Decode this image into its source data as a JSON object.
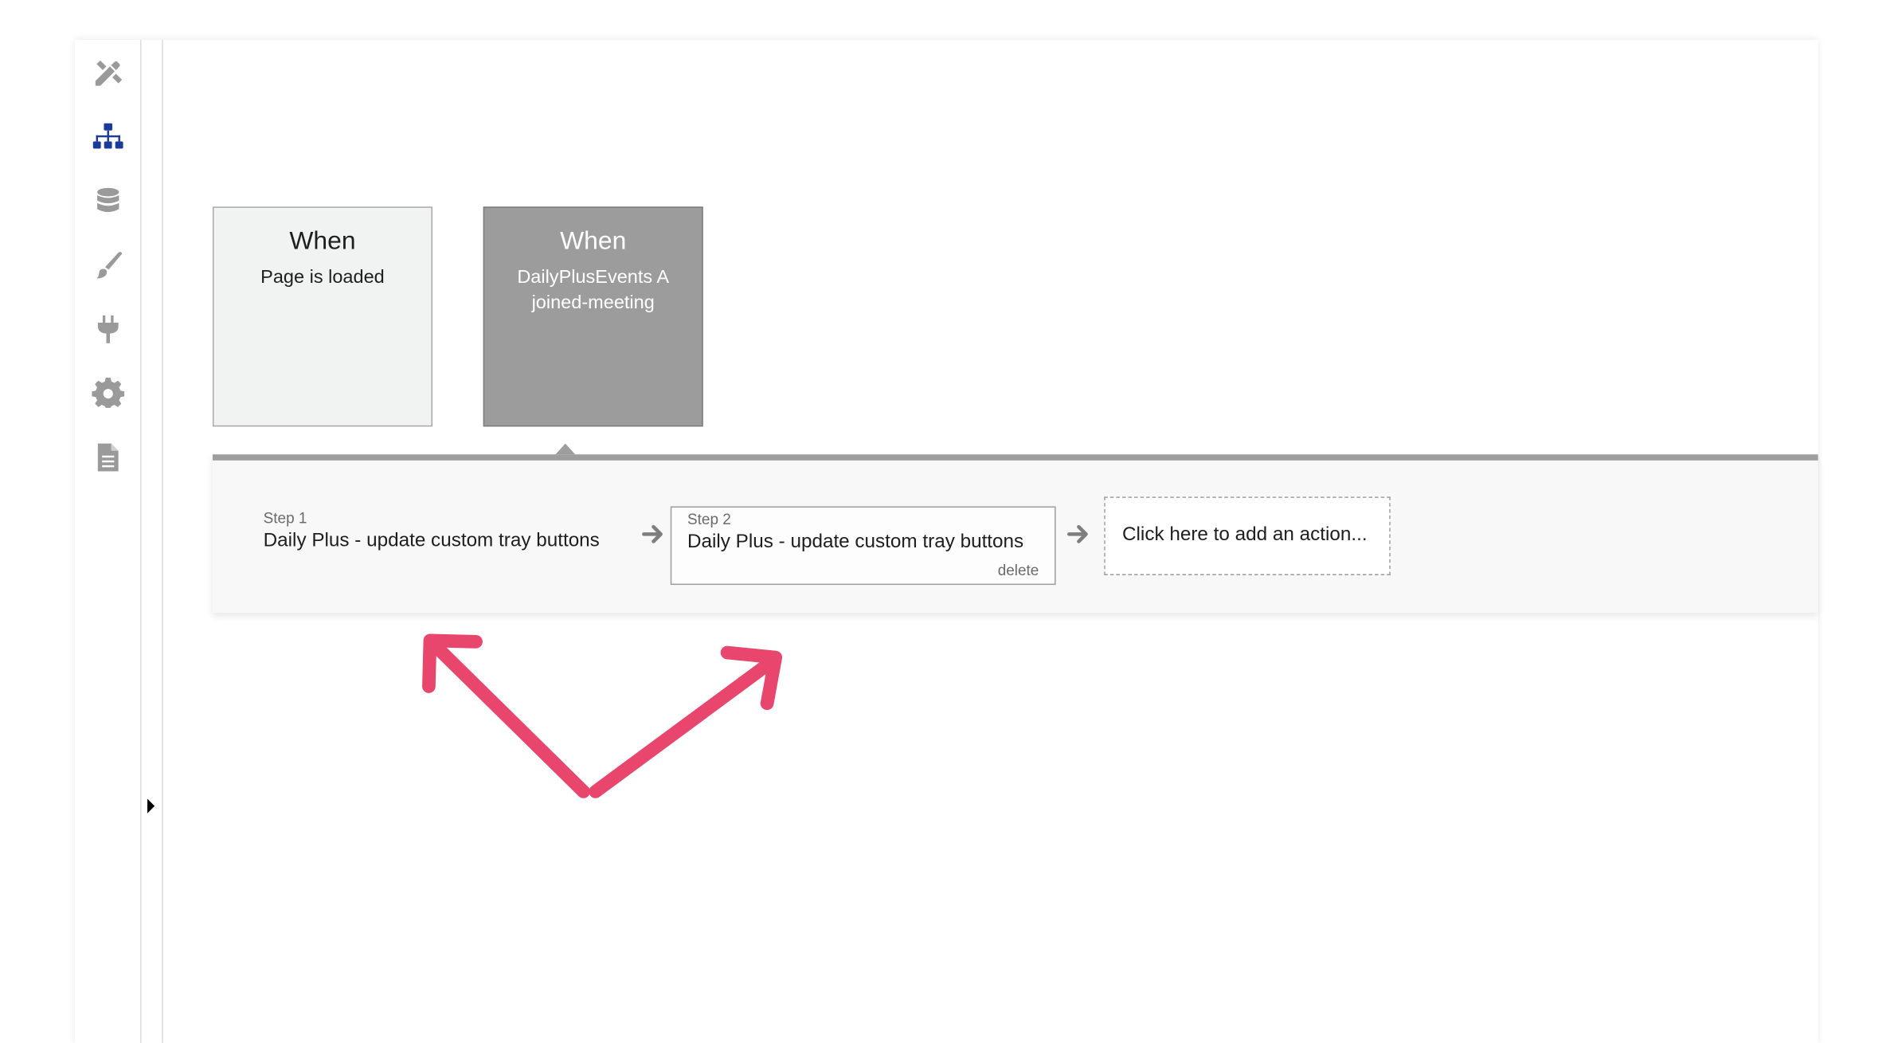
{
  "sidebar": {
    "items": [
      {
        "name": "design",
        "icon": "design-tools-icon",
        "active": false
      },
      {
        "name": "workflow",
        "icon": "workflow-sitemap-icon",
        "active": true
      },
      {
        "name": "data",
        "icon": "database-icon",
        "active": false
      },
      {
        "name": "styles",
        "icon": "paintbrush-icon",
        "active": false
      },
      {
        "name": "plugins",
        "icon": "plug-icon",
        "active": false
      },
      {
        "name": "settings",
        "icon": "gear-icon",
        "active": false
      },
      {
        "name": "logs",
        "icon": "document-icon",
        "active": false
      }
    ],
    "active_color": "#1a3b9c",
    "icon_color": "#9a9a9a",
    "collapse_icon": "caret-right-icon"
  },
  "events": [
    {
      "when_label": "When",
      "trigger": "Page is loaded",
      "selected": false
    },
    {
      "when_label": "When",
      "trigger": "DailyPlusEvents A joined-meeting",
      "selected": true
    }
  ],
  "actions": {
    "steps": [
      {
        "label": "Step 1",
        "title": "Daily Plus - update custom tray buttons"
      },
      {
        "label": "Step 2",
        "title": "Daily Plus - update custom tray buttons",
        "delete_label": "delete"
      }
    ],
    "add_action_label": "Click here to add an action...",
    "arrow_icon": "arrow-right-icon"
  },
  "annotation": {
    "icon": "double-arrow-annotation-icon",
    "color": "#e8466d"
  }
}
